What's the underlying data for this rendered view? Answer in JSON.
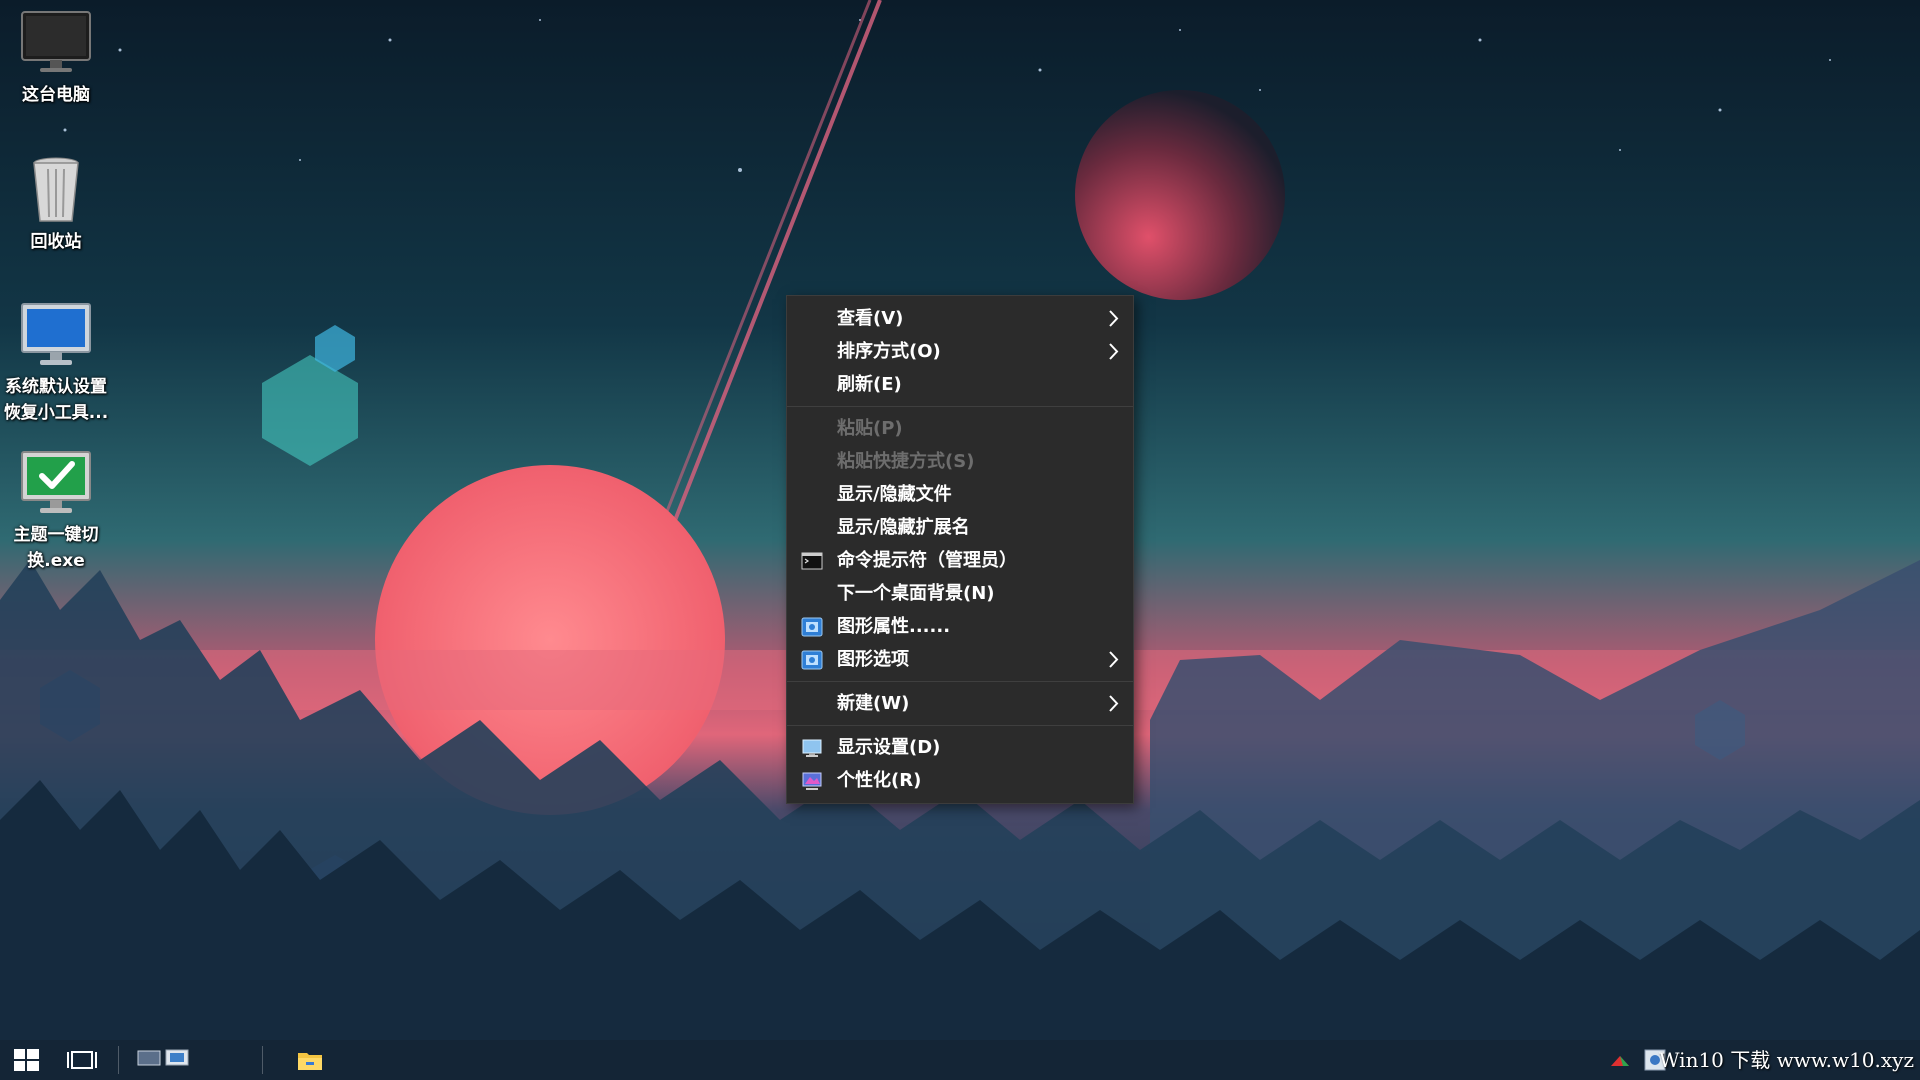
{
  "desktop": {
    "icons": [
      {
        "label": "这台电脑",
        "icon": "computer-icon"
      },
      {
        "label": "回收站",
        "icon": "recycle-bin-icon"
      },
      {
        "label": "系统默认设置\n恢复小工具...",
        "icon": "monitor-icon"
      },
      {
        "label": "主题一键切\n换.exe",
        "icon": "checkmark-app-icon"
      }
    ]
  },
  "context_menu": {
    "items": [
      {
        "label": "查看(V)",
        "submenu": true
      },
      {
        "label": "排序方式(O)",
        "submenu": true
      },
      {
        "label": "刷新(E)"
      },
      {
        "label": "粘贴(P)",
        "disabled": true
      },
      {
        "label": "粘贴快捷方式(S)",
        "disabled": true
      },
      {
        "label": "显示/隐藏文件"
      },
      {
        "label": "显示/隐藏扩展名"
      },
      {
        "label": "命令提示符（管理员）",
        "icon": "cmd-icon"
      },
      {
        "label": "下一个桌面背景(N)"
      },
      {
        "label": "图形属性......",
        "icon": "graphics-icon"
      },
      {
        "label": "图形选项",
        "icon": "graphics-icon",
        "submenu": true
      },
      {
        "label": "新建(W)",
        "submenu": true
      },
      {
        "label": "显示设置(D)",
        "icon": "display-icon"
      },
      {
        "label": "个性化(R)",
        "icon": "personalize-icon"
      }
    ]
  },
  "taskbar": {
    "watermark": "Win10 下载 www.w10.xyz",
    "buttons": [
      "start-icon",
      "task-view-icon",
      "desktop-switch-icon",
      "file-explorer-icon"
    ]
  },
  "colors": {
    "menu_bg": "#2b2b2b",
    "menu_text": "#ffffff",
    "menu_disabled": "#6d6d6d",
    "sky_top": "#0b1c2a",
    "horizon": "#d75a6e"
  }
}
